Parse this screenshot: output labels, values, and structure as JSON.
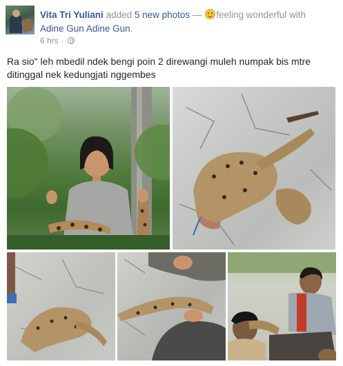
{
  "post": {
    "author": "Vita Tri Yuliani",
    "action_prefix": "added",
    "photos_link": "5 new photos",
    "separator": "—",
    "feeling_text": "feeling wonderful with",
    "tagged_1": "Adine Gun",
    "tagged_2": "Adine Gun",
    "period": ".",
    "timestamp": "6 hrs",
    "middot": "·",
    "audience_icon": "globe-icon",
    "feeling_icon": "smiley-emoji-icon",
    "body_text": "Ra sio\" leh mbedil ndek bengi poin 2 direwangi muleh numpak bis mtre ditinggal nek kedungjati nggembes"
  },
  "photos": [
    {
      "id": "photo-1",
      "subject": "girl-holding-wild-cat"
    },
    {
      "id": "photo-2",
      "subject": "dead-cat-on-concrete"
    },
    {
      "id": "photo-3",
      "subject": "cat-on-ground"
    },
    {
      "id": "photo-4",
      "subject": "cat-being-handled"
    },
    {
      "id": "photo-5",
      "subject": "men-with-cat"
    }
  ],
  "colors": {
    "link": "#365899",
    "meta": "#90949c",
    "text": "#1d2129"
  }
}
